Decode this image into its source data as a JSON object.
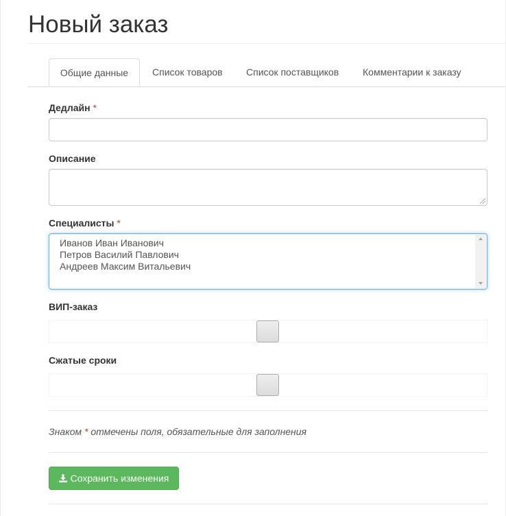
{
  "page": {
    "title": "Новый заказ"
  },
  "tabs": [
    {
      "label": "Общие данные",
      "active": true
    },
    {
      "label": "Список товаров",
      "active": false
    },
    {
      "label": "Список поставщиков",
      "active": false
    },
    {
      "label": "Комментарии к заказу",
      "active": false
    }
  ],
  "form": {
    "required_mark": "*",
    "deadline": {
      "label": "Дедлайн",
      "value": ""
    },
    "description": {
      "label": "Описание",
      "value": ""
    },
    "specialists": {
      "label": "Специалисты",
      "options": [
        "Иванов Иван Иванович",
        "Петров Василий Павлович",
        "Андреев Максим Витальевич"
      ]
    },
    "vip": {
      "label": "ВИП-заказ",
      "checked": false
    },
    "urgent": {
      "label": "Сжатые сроки",
      "checked": false
    },
    "note": {
      "prefix": "Знаком",
      "suffix": "отмечены поля, обязательные для заполнения"
    },
    "save_label": "Сохранить изменения"
  },
  "colors": {
    "accent_green": "#5cb85c",
    "required_red": "#a94442",
    "focus_blue": "#66afe9"
  },
  "icons": {
    "save": "download-icon"
  }
}
